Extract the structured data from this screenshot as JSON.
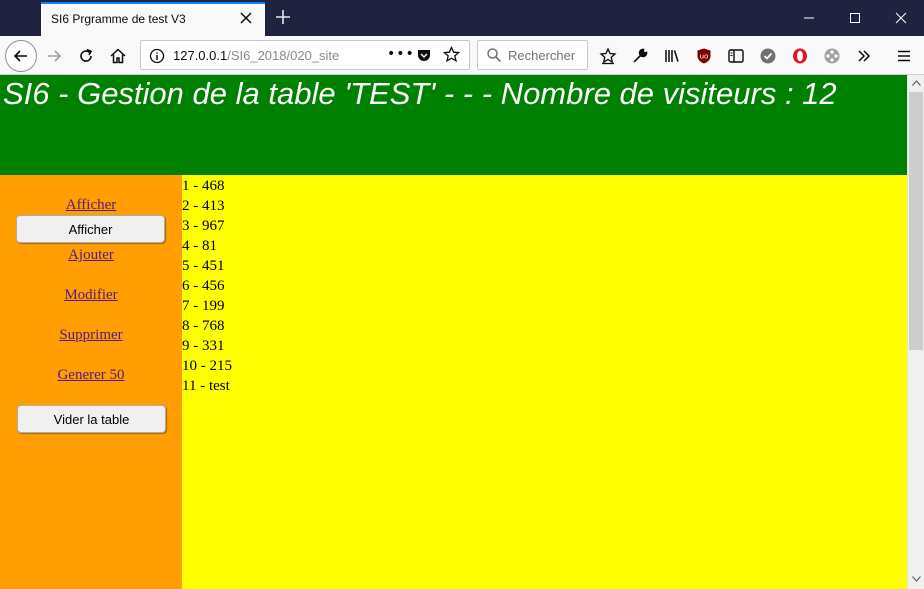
{
  "browser": {
    "tab_title": "SI6 Prgramme de test V3",
    "url_host": "127.0.0.1",
    "url_path": "/SI6_2018/020_site",
    "search_placeholder": "Rechercher"
  },
  "page": {
    "title": "SI6 - Gestion de la table 'TEST' - - - Nombre de visiteurs : 12",
    "colors": {
      "header": "#008000",
      "sidebar": "#ff9e00",
      "main": "#ffff00"
    }
  },
  "sidebar": {
    "link_afficher": "Afficher",
    "button_afficher": "Afficher",
    "link_ajouter": "Ajouter",
    "link_modifier": "Modifier",
    "link_supprimer": "Supprimer",
    "link_generer": "Generer 50",
    "button_vider": "Vider la table"
  },
  "rows": [
    "1 - 468",
    "2 - 413",
    "3 - 967",
    "4 - 81",
    "5 - 451",
    "6 - 456",
    "7 - 199",
    "8 - 768",
    "9 - 331",
    "10 - 215",
    "11 - test"
  ]
}
